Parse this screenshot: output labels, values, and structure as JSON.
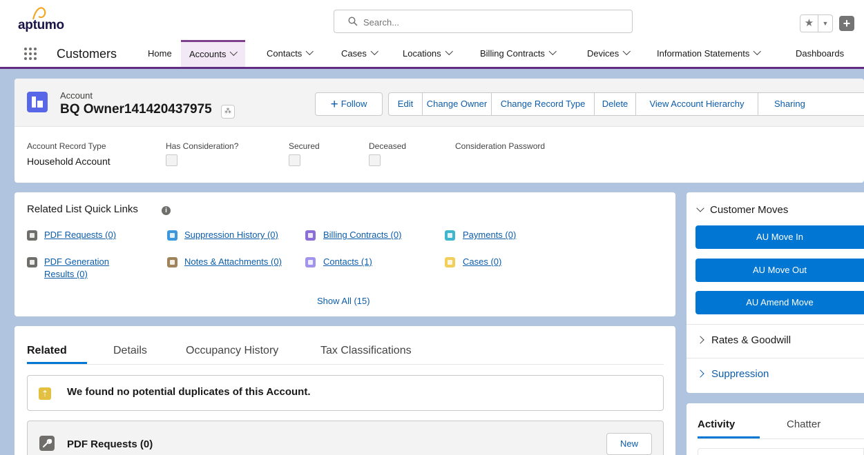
{
  "header": {
    "logo_text": "aptumo",
    "search_placeholder": "Search..."
  },
  "nav": {
    "app_name": "Customers",
    "items": [
      {
        "label": "Home"
      },
      {
        "label": "Accounts"
      },
      {
        "label": "Contacts"
      },
      {
        "label": "Cases"
      },
      {
        "label": "Locations"
      },
      {
        "label": "Billing Contracts"
      },
      {
        "label": "Devices"
      },
      {
        "label": "Information Statements"
      },
      {
        "label": "Dashboards"
      }
    ]
  },
  "record": {
    "object_label": "Account",
    "title": "BQ Owner141420437975",
    "actions": {
      "follow": "Follow",
      "edit": "Edit",
      "change_owner": "Change Owner",
      "change_record_type": "Change Record Type",
      "delete": "Delete",
      "view_hierarchy": "View Account Hierarchy",
      "sharing": "Sharing"
    },
    "fields": {
      "record_type_label": "Account Record Type",
      "record_type_value": "Household Account",
      "has_consideration_label": "Has Consideration?",
      "secured_label": "Secured",
      "deceased_label": "Deceased",
      "consideration_password_label": "Consideration Password"
    }
  },
  "quick_links": {
    "title": "Related List Quick Links",
    "items": [
      {
        "label": "PDF Requests (0)",
        "color": "#706e6b"
      },
      {
        "label": "Suppression History (0)",
        "color": "#3c97dd"
      },
      {
        "label": "Billing Contracts (0)",
        "color": "#8b6fd6"
      },
      {
        "label": "Payments (0)",
        "color": "#3fb6ce"
      },
      {
        "label": "PDF Generation",
        "label2": "Results (0)",
        "color": "#706e6b"
      },
      {
        "label": "Notes & Attachments (0)",
        "color": "#a0835a"
      },
      {
        "label": "Contacts (1)",
        "color": "#a094ed"
      },
      {
        "label": "Cases (0)",
        "color": "#f2cf5b"
      }
    ],
    "show_all": "Show All (15)"
  },
  "tabs": {
    "items": [
      {
        "label": "Related"
      },
      {
        "label": "Details"
      },
      {
        "label": "Occupancy History"
      },
      {
        "label": "Tax Classifications"
      }
    ],
    "duplicates_text": "We found no potential duplicates of this Account.",
    "pdf_requests_title": "PDF Requests (0)",
    "new_button": "New"
  },
  "customer_moves": {
    "title": "Customer Moves",
    "buttons": [
      "AU Move In",
      "AU Move Out",
      "AU Amend Move"
    ],
    "rates_title": "Rates & Goodwill",
    "suppression_title": "Suppression"
  },
  "activity": {
    "tabs": [
      "Activity",
      "Chatter"
    ]
  },
  "colors": {
    "brand_nav_underline": "#5f2c82",
    "primary_button": "#0176d3",
    "link": "#0b5cab",
    "page_background": "#b0c4df"
  }
}
